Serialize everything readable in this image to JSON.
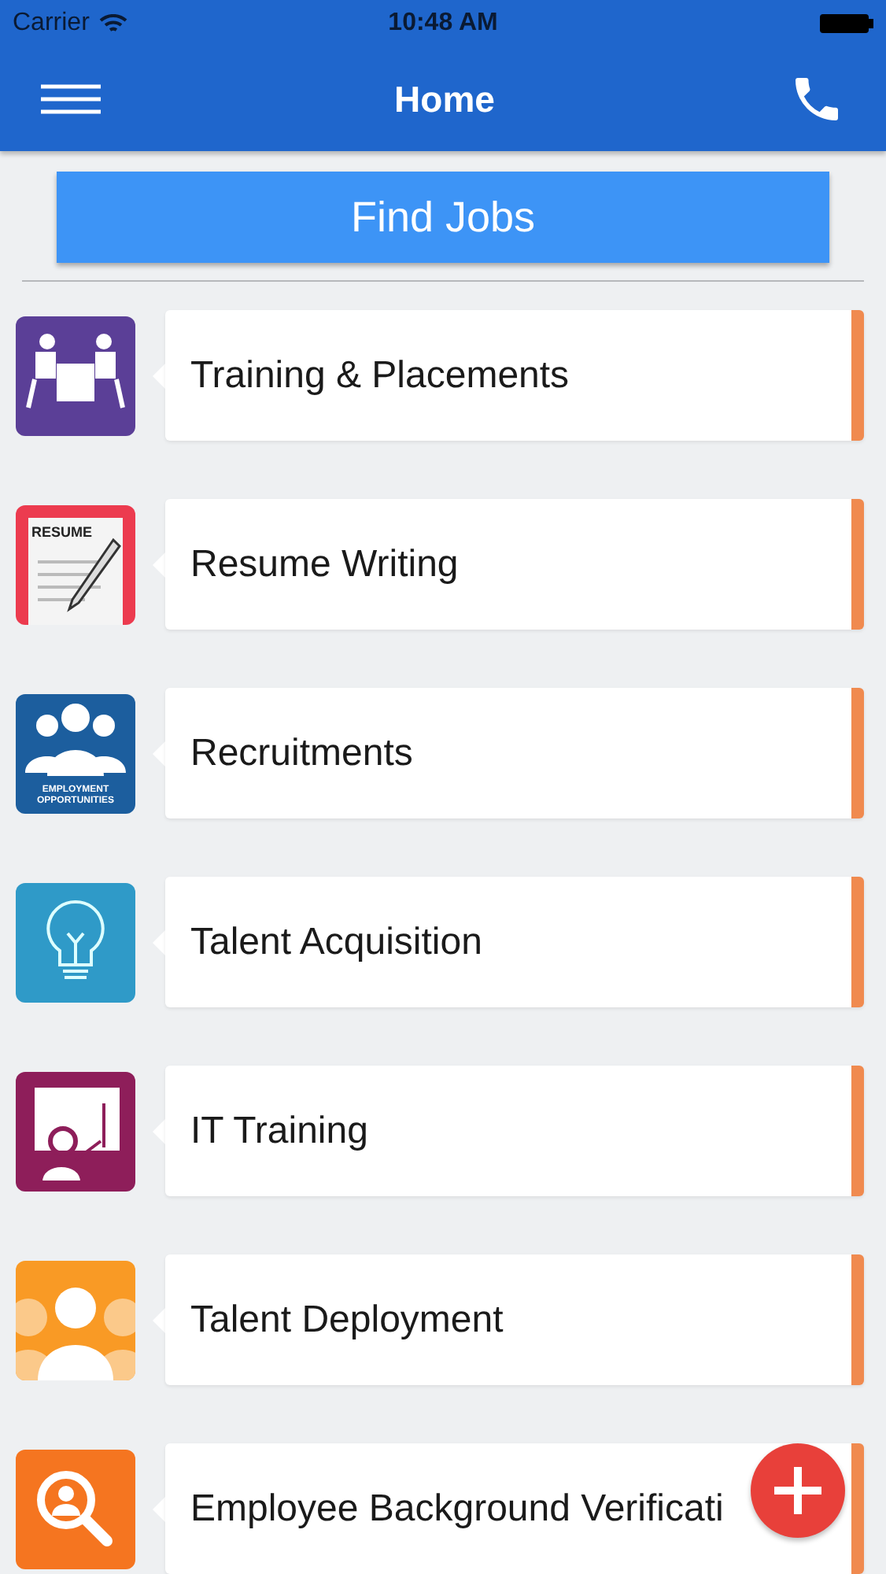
{
  "status_bar": {
    "carrier": "Carrier",
    "time": "10:48 AM"
  },
  "nav_bar": {
    "title": "Home"
  },
  "find_jobs_button": {
    "label": "Find Jobs"
  },
  "items": [
    {
      "kind": "meeting",
      "label": "Training & Placements"
    },
    {
      "kind": "resume",
      "label": "Resume Writing",
      "icon_text": "RESUME"
    },
    {
      "kind": "team",
      "label": "Recruitments",
      "icon_text": "EMPLOYMENT OPPORTUNITIES"
    },
    {
      "kind": "bulb",
      "label": "Talent Acquisition"
    },
    {
      "kind": "teacher",
      "label": "IT Training"
    },
    {
      "kind": "people",
      "label": "Talent Deployment"
    },
    {
      "kind": "search",
      "label": "Employee Background Verificati"
    }
  ]
}
